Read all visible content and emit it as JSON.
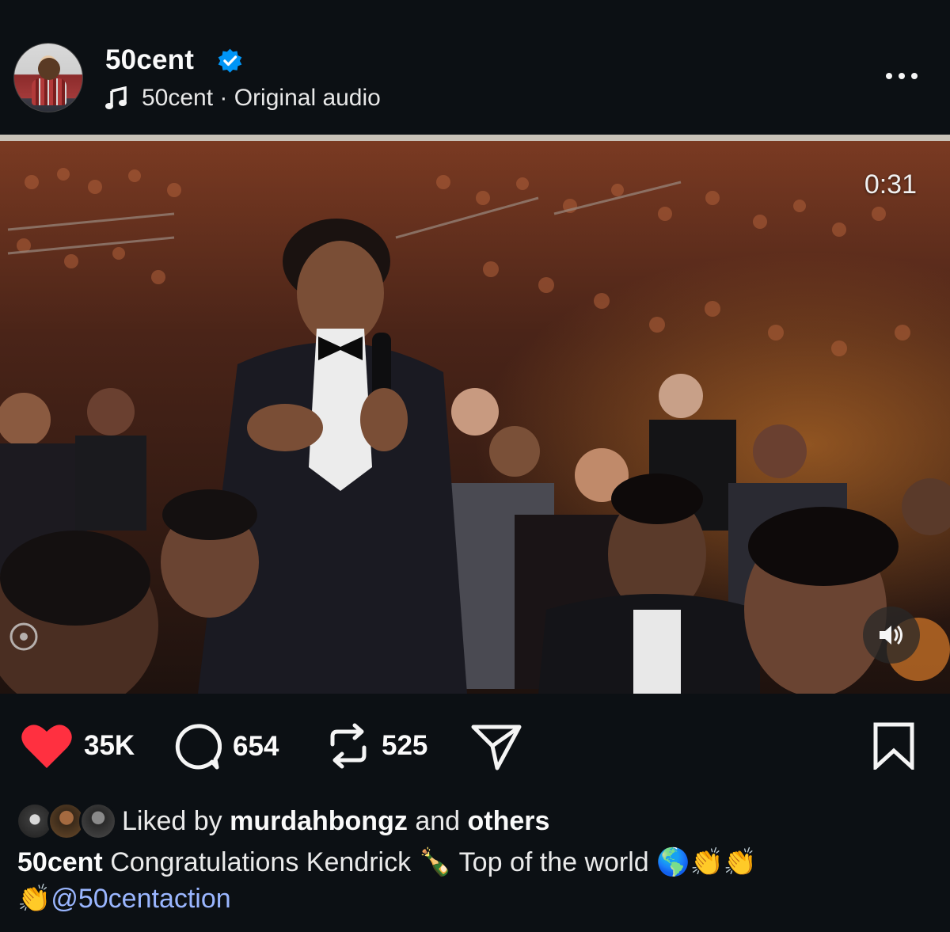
{
  "header": {
    "username": "50cent",
    "verified_icon": "verified-badge-icon",
    "audio_icon": "music-note-icon",
    "audio_label": "50cent · Original audio",
    "more_icon": "more-options-icon"
  },
  "video": {
    "timer": "0:31",
    "mute_icon": "speaker-icon"
  },
  "actions": {
    "likes": "35K",
    "comments": "654",
    "reposts": "525",
    "colors": {
      "like": "#ff3040",
      "icon": "#f5f5f5"
    }
  },
  "liked_by": {
    "prefix": "Liked by",
    "user": "murdahbongz",
    "and": "and",
    "others": "others"
  },
  "caption": {
    "username": "50cent",
    "text": "Congratulations Kendrick 🍾 Top of the world 🌎👏👏",
    "line2_emoji": "👏",
    "mention": "@50centaction"
  }
}
